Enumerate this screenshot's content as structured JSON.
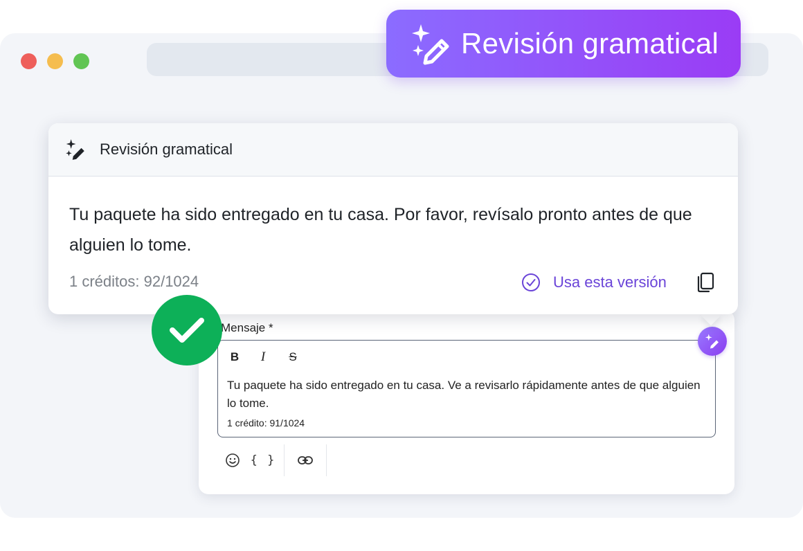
{
  "badge": {
    "label": "Revisión gramatical"
  },
  "suggestion_card": {
    "title": "Revisión gramatical",
    "text": "Tu paquete ha sido entregado en tu casa. Por favor, revísalo pronto antes de que alguien lo tome.",
    "credits": "1 créditos: 92/1024",
    "use_version_label": "Usa esta versión"
  },
  "compose": {
    "label": "Mensaje *",
    "format_buttons": {
      "bold": "B",
      "italic": "I",
      "strike": "S"
    },
    "text": "Tu paquete ha sido entregado en tu casa. Ve a revisarlo rápidamente antes de que alguien lo tome.",
    "credits": "1 crédito: 91/1024",
    "variables_label": "{ }"
  },
  "colors": {
    "accent": "#6a44d8",
    "badge_gradient_start": "#8b6cff",
    "badge_gradient_end": "#9a3cf5",
    "success": "#0db058"
  },
  "icons": {
    "badge": "sparkle-pen-icon",
    "card": "sparkle-pen-icon",
    "use_version": "check-circle-icon",
    "copy": "copy-icon",
    "success": "checkmark-icon",
    "emoji": "emoji-icon",
    "link": "link-icon"
  }
}
